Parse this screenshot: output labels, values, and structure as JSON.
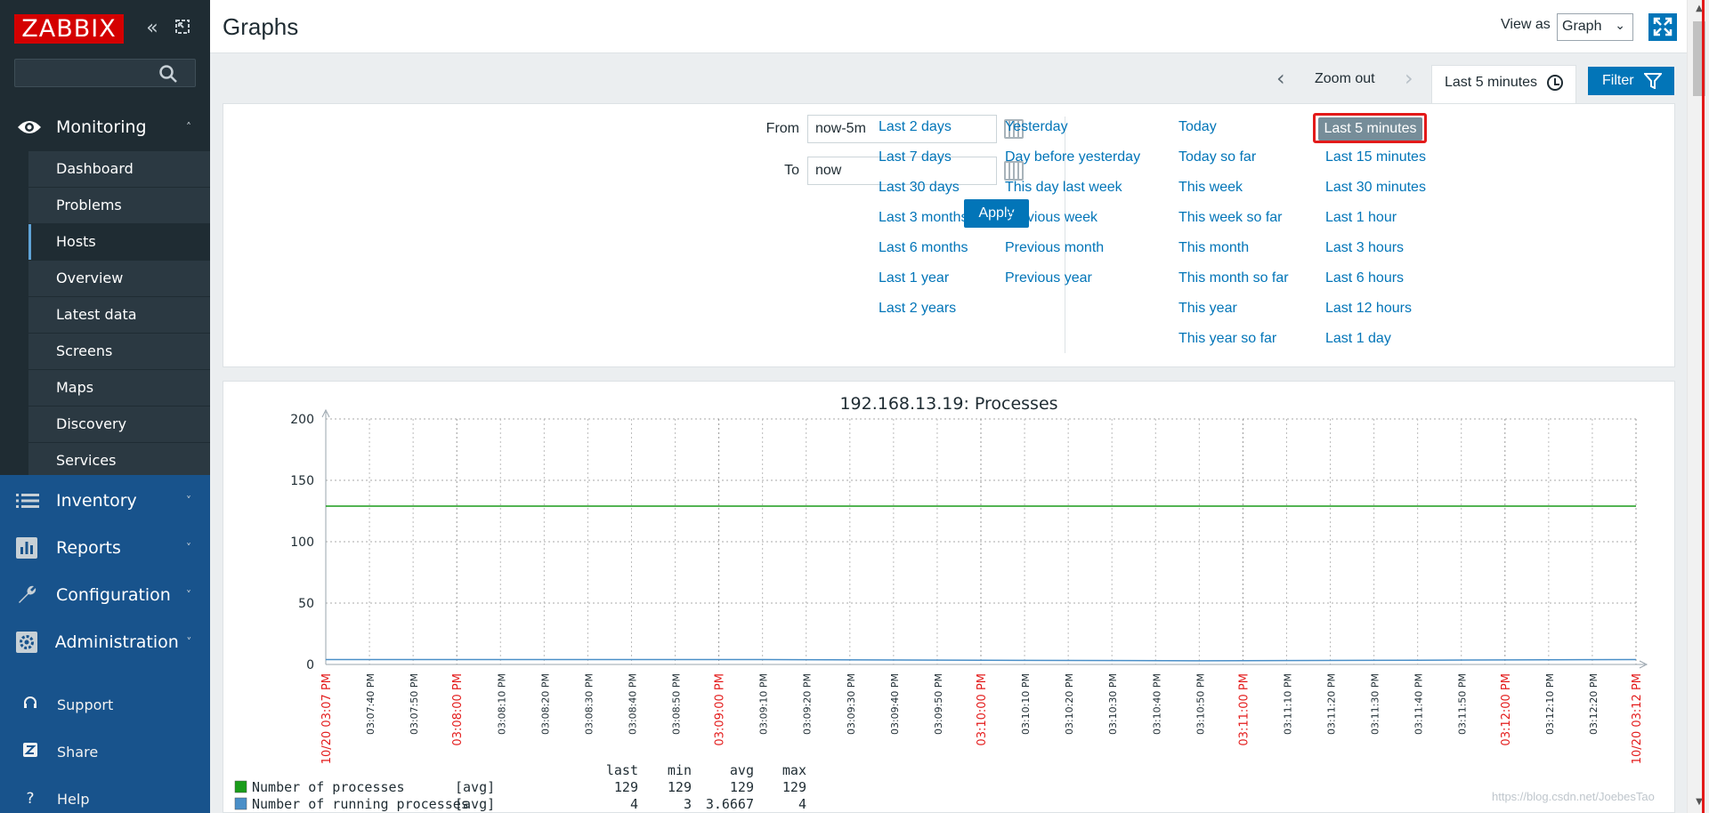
{
  "sidebar": {
    "logo": "ZABBIX",
    "sections": {
      "monitoring": "Monitoring",
      "inventory": "Inventory",
      "reports": "Reports",
      "configuration": "Configuration",
      "administration": "Administration"
    },
    "submenu": [
      "Dashboard",
      "Problems",
      "Hosts",
      "Overview",
      "Latest data",
      "Screens",
      "Maps",
      "Discovery",
      "Services"
    ],
    "active_item": "Hosts",
    "utils": [
      "Support",
      "Share",
      "Help"
    ]
  },
  "header": {
    "title": "Graphs",
    "view_as_label": "View as",
    "view_as_value": "Graph"
  },
  "timebar": {
    "zoom_out": "Zoom out",
    "current_range": "Last 5 minutes",
    "filter_label": "Filter"
  },
  "filter": {
    "from_label": "From",
    "from_value": "now-5m",
    "to_label": "To",
    "to_value": "now",
    "apply": "Apply",
    "quick": {
      "col1": [
        "Last 2 days",
        "Last 7 days",
        "Last 30 days",
        "Last 3 months",
        "Last 6 months",
        "Last 1 year",
        "Last 2 years"
      ],
      "col2": [
        "Yesterday",
        "Day before yesterday",
        "This day last week",
        "Previous week",
        "Previous month",
        "Previous year"
      ],
      "col3": [
        "Today",
        "Today so far",
        "This week",
        "This week so far",
        "This month",
        "This month so far",
        "This year",
        "This year so far"
      ],
      "col4": [
        "Last 5 minutes",
        "Last 15 minutes",
        "Last 30 minutes",
        "Last 1 hour",
        "Last 3 hours",
        "Last 6 hours",
        "Last 12 hours",
        "Last 1 day"
      ]
    },
    "selected": "Last 5 minutes"
  },
  "colors": {
    "accent": "#0275b8",
    "sidebar_bg": "#1f2c33",
    "sidebar_lower_bg": "#18538c",
    "series_processes": "#1a9c1a",
    "series_running": "#4a8fc8",
    "time_marker": "#e31a1a"
  },
  "chart_data": {
    "type": "line",
    "title": "192.168.13.19: Processes",
    "ylim": [
      0,
      200
    ],
    "yticks": [
      "200",
      "150",
      "100",
      "50",
      "0"
    ],
    "xticks": [
      "10/20 03:07 PM",
      "03:07:40 PM",
      "03:07:50 PM",
      "03:08:00 PM",
      "03:08:10 PM",
      "03:08:20 PM",
      "03:08:30 PM",
      "03:08:40 PM",
      "03:08:50 PM",
      "03:09:00 PM",
      "03:09:10 PM",
      "03:09:20 PM",
      "03:09:30 PM",
      "03:09:40 PM",
      "03:09:50 PM",
      "03:10:00 PM",
      "03:10:10 PM",
      "03:10:20 PM",
      "03:10:30 PM",
      "03:10:40 PM",
      "03:10:50 PM",
      "03:11:00 PM",
      "03:11:10 PM",
      "03:11:20 PM",
      "03:11:30 PM",
      "03:11:40 PM",
      "03:11:50 PM",
      "03:12:00 PM",
      "03:12:10 PM",
      "03:12:20 PM",
      "10/20 03:12 PM"
    ],
    "red_ticks": [
      "10/20 03:07 PM",
      "03:08:00 PM",
      "03:09:00 PM",
      "03:10:00 PM",
      "03:11:00 PM",
      "03:12:00 PM",
      "10/20 03:12 PM"
    ],
    "legend_headers": [
      "last",
      "min",
      "avg",
      "max"
    ],
    "series": [
      {
        "name": "Number of processes",
        "func": "[avg]",
        "values": [
          129,
          129,
          129,
          129,
          129,
          129,
          129
        ],
        "last": "129",
        "min": "129",
        "avg": "129",
        "max": "129"
      },
      {
        "name": "Number of running processes",
        "func": "[avg]",
        "values": [
          4,
          4,
          4,
          3.5,
          3,
          3.5,
          4
        ],
        "last": "4",
        "min": "3",
        "avg": "3.6667",
        "max": "4"
      }
    ]
  },
  "watermark": "https://blog.csdn.net/JoebesTao"
}
